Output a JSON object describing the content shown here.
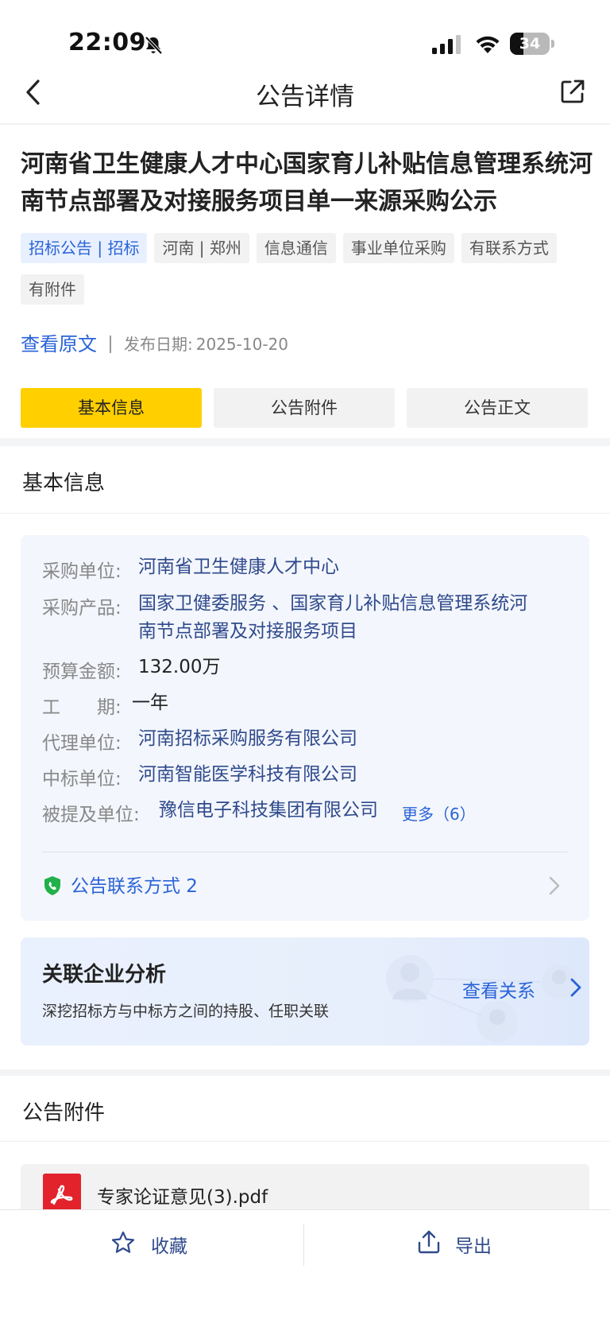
{
  "status_bar": {
    "time": "22:09",
    "battery": "34",
    "battery_level_percent": 34
  },
  "nav": {
    "title": "公告详情"
  },
  "notice": {
    "title": "河南省卫生健康人才中心国家育儿补贴信息管理系统河南节点部署及对接服务项目单一来源采购公示",
    "tags": [
      "招标公告 | 招标",
      "河南 | 郑州",
      "信息通信",
      "事业单位采购",
      "有联系方式",
      "有附件"
    ],
    "view_original": "查看原文",
    "publish_label": "发布日期:",
    "publish_date": "2025-10-20"
  },
  "tabs": [
    {
      "label": "基本信息",
      "active": true
    },
    {
      "label": "公告附件",
      "active": false
    },
    {
      "label": "公告正文",
      "active": false
    }
  ],
  "basic_info": {
    "section_title": "基本信息",
    "fields": [
      {
        "label": "采购单位:",
        "value": "河南省卫生健康人才中心"
      },
      {
        "label": "采购产品:",
        "value_line1": "国家卫健委服务 、国家育儿补贴信息管理系统河",
        "value_line2": "南节点部署及对接服务项目"
      },
      {
        "label": "预算金额:",
        "value": "132.00万"
      },
      {
        "label": "工　　期:",
        "value": "一年"
      },
      {
        "label": "代理单位:",
        "value": "河南招标采购服务有限公司"
      },
      {
        "label": "中标单位:",
        "value": "河南智能医学科技有限公司"
      },
      {
        "label": "被提及单位:",
        "value": "豫信电子科技集团有限公司",
        "more": "更多（6）"
      }
    ],
    "contact": "公告联系方式 2"
  },
  "relation": {
    "title": "关联企业分析",
    "subtitle": "深挖招标方与中标方之间的持股、任职关联",
    "link": "查看关系"
  },
  "attachments": {
    "section_title": "公告附件",
    "files": [
      {
        "name": "专家论证意见(3).pdf"
      }
    ]
  },
  "bottom": {
    "favorite": "收藏",
    "export": "导出"
  },
  "colors": {
    "accent_blue": "#2a63d8",
    "active_tab": "#ffcf00",
    "link_dark_blue": "#2f4a8c",
    "pdf_red": "#e3232c",
    "shield_green": "#22b04a"
  }
}
